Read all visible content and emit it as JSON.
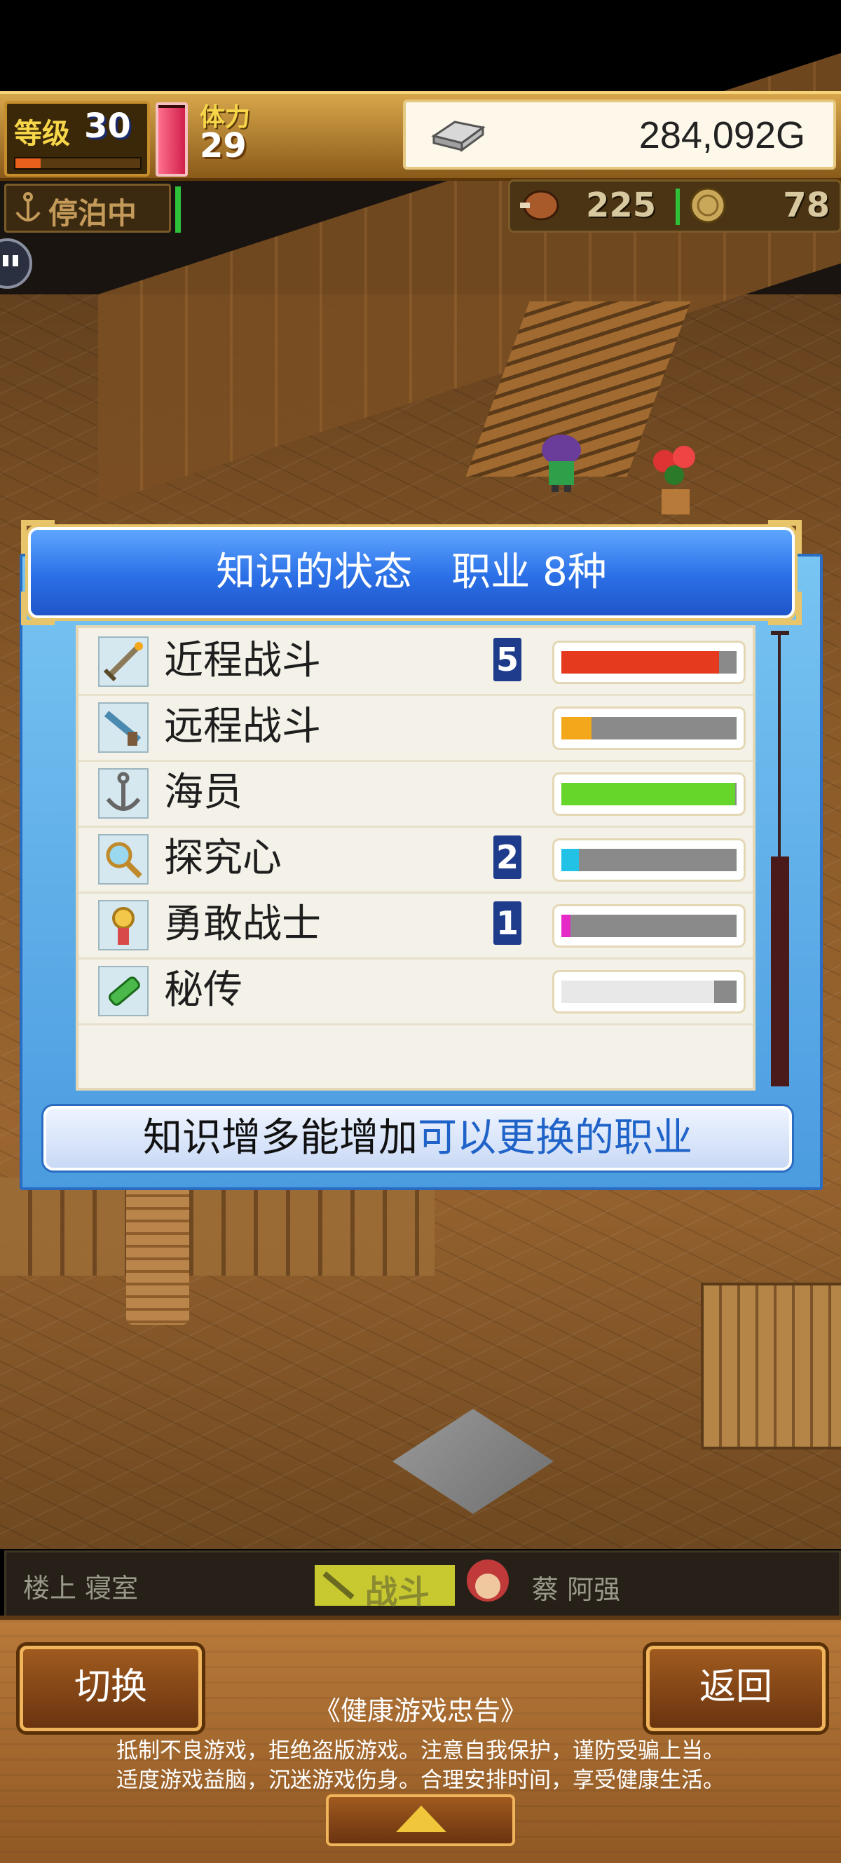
{
  "hud": {
    "level_label": "等级",
    "level_value": "30",
    "level_progress": 0.2,
    "hp_fraction": 0.96,
    "stamina_label": "体力",
    "stamina_value": "29",
    "gold_value": "284,092G",
    "status_label": "停泊中",
    "food_value": "225",
    "coin_value": "78"
  },
  "panel": {
    "title": "知识的状态　职业 8种",
    "rows": [
      {
        "label": "近程战斗",
        "count": "5",
        "icon": "sword-icon",
        "fill": 0.9,
        "color": "#e63a1e"
      },
      {
        "label": "远程战斗",
        "count": "",
        "icon": "gun-icon",
        "fill": 0.17,
        "color": "#f3a81c"
      },
      {
        "label": "海员",
        "count": "",
        "icon": "anchor-icon",
        "fill": 0.99,
        "color": "#66d62a"
      },
      {
        "label": "探究心",
        "count": "2",
        "icon": "magnifier-icon",
        "fill": 0.1,
        "color": "#22c2e6"
      },
      {
        "label": "勇敢战士",
        "count": "1",
        "icon": "medal-icon",
        "fill": 0.05,
        "color": "#e62ac8"
      },
      {
        "label": "秘传",
        "count": "",
        "icon": "scroll-icon",
        "fill": 0.87,
        "color": "#e8e8e8"
      }
    ],
    "hint_normal": "知识增多能增加",
    "hint_highlight": "可以更换的职业"
  },
  "location": {
    "place": "楼上 寝室",
    "mode": "战斗",
    "character": "蔡 阿强"
  },
  "bottom": {
    "switch_label": "切换",
    "back_label": "返回",
    "notice_title": "《健康游戏忠告》",
    "notice_line1": "抵制不良游戏，拒绝盗版游戏。注意自我保护，谨防受骗上当。",
    "notice_line2": "适度游戏益脑，沉迷游戏伤身。合理安排时间，享受健康生活。"
  },
  "colors": {
    "panel_blue": "#2b6fe6",
    "hint_highlight": "#1f63c9",
    "gold": "#f0b45a"
  }
}
